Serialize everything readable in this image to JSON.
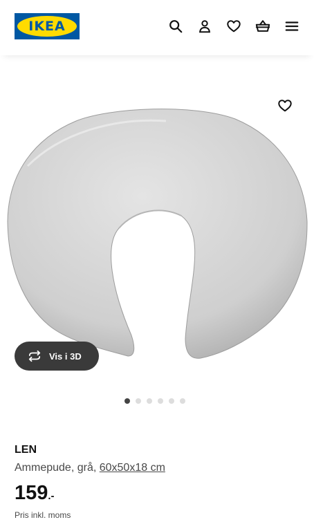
{
  "header": {
    "logo_text": "IKEA",
    "icons": [
      "search-icon",
      "user-icon",
      "heart-icon",
      "basket-icon",
      "menu-icon"
    ]
  },
  "gallery": {
    "vis3d_label": "Vis i 3D",
    "dots_total": 6,
    "active_dot": 1
  },
  "product": {
    "name": "LEN",
    "desc_prefix": "Ammepude, grå, ",
    "dimensions": "60x50x18 cm",
    "price_integer": "159",
    "price_suffix": ".-",
    "price_note": "Pris inkl. moms"
  },
  "colors": {
    "brand_blue": "#0058a3",
    "brand_yellow": "#ffdb00",
    "pill_bg": "#3a3a3a"
  }
}
